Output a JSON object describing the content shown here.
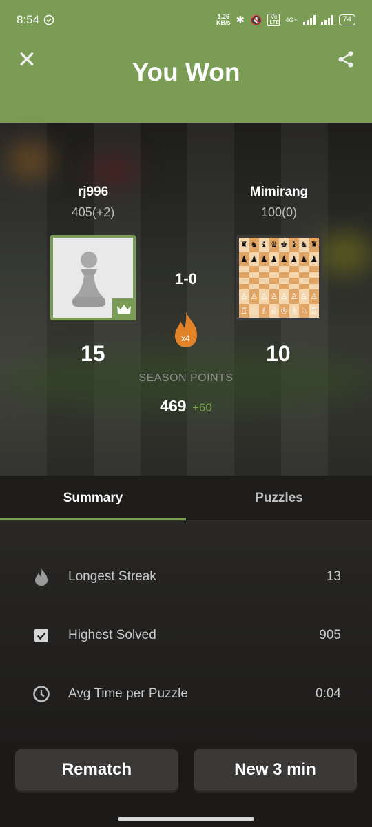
{
  "status_bar": {
    "time": "8:54",
    "speed": "1.26",
    "speed_unit": "KB/s",
    "network": "4G+",
    "volte": "Vo LTE",
    "battery": "74"
  },
  "header": {
    "title": "You Won",
    "close_icon": "close-icon",
    "share_icon": "share-icon",
    "color": "#7a9c55"
  },
  "players": {
    "left": {
      "name": "rj996",
      "rating": "405(+2)",
      "points": "15"
    },
    "right": {
      "name": "Mimirang",
      "rating": "100(0)",
      "points": "10"
    }
  },
  "result": {
    "score": "1-0",
    "streak_multiplier": "x4"
  },
  "season": {
    "label": "SEASON POINTS",
    "value": "469",
    "delta": "+60"
  },
  "tabs": [
    {
      "label": "Summary",
      "active": true
    },
    {
      "label": "Puzzles",
      "active": false
    }
  ],
  "stats": [
    {
      "icon": "flame-icon",
      "label": "Longest Streak",
      "value": "13"
    },
    {
      "icon": "checkbox-icon",
      "label": "Highest Solved",
      "value": "905"
    },
    {
      "icon": "clock-icon",
      "label": "Avg Time per Puzzle",
      "value": "0:04"
    }
  ],
  "buttons": {
    "rematch": "Rematch",
    "new_game": "New 3 min"
  }
}
